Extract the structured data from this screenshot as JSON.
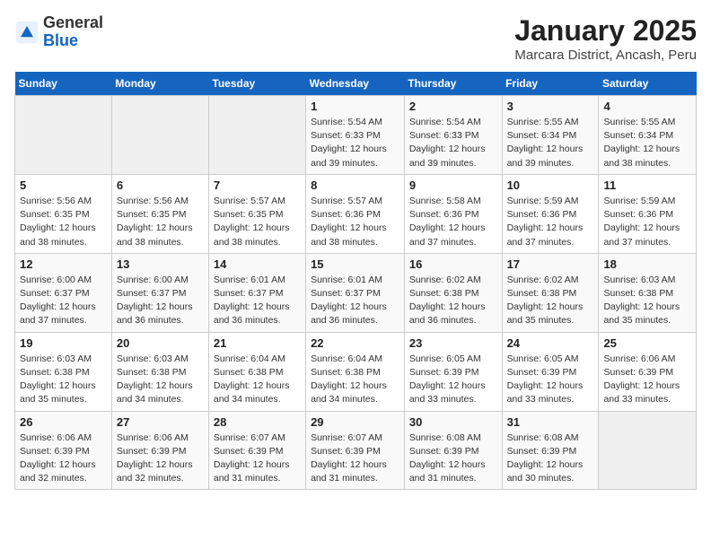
{
  "header": {
    "logo_general": "General",
    "logo_blue": "Blue",
    "title": "January 2025",
    "subtitle": "Marcara District, Ancash, Peru"
  },
  "days_of_week": [
    "Sunday",
    "Monday",
    "Tuesday",
    "Wednesday",
    "Thursday",
    "Friday",
    "Saturday"
  ],
  "weeks": [
    [
      {
        "day": "",
        "info": ""
      },
      {
        "day": "",
        "info": ""
      },
      {
        "day": "",
        "info": ""
      },
      {
        "day": "1",
        "info": "Sunrise: 5:54 AM\nSunset: 6:33 PM\nDaylight: 12 hours and 39 minutes."
      },
      {
        "day": "2",
        "info": "Sunrise: 5:54 AM\nSunset: 6:33 PM\nDaylight: 12 hours and 39 minutes."
      },
      {
        "day": "3",
        "info": "Sunrise: 5:55 AM\nSunset: 6:34 PM\nDaylight: 12 hours and 39 minutes."
      },
      {
        "day": "4",
        "info": "Sunrise: 5:55 AM\nSunset: 6:34 PM\nDaylight: 12 hours and 38 minutes."
      }
    ],
    [
      {
        "day": "5",
        "info": "Sunrise: 5:56 AM\nSunset: 6:35 PM\nDaylight: 12 hours and 38 minutes."
      },
      {
        "day": "6",
        "info": "Sunrise: 5:56 AM\nSunset: 6:35 PM\nDaylight: 12 hours and 38 minutes."
      },
      {
        "day": "7",
        "info": "Sunrise: 5:57 AM\nSunset: 6:35 PM\nDaylight: 12 hours and 38 minutes."
      },
      {
        "day": "8",
        "info": "Sunrise: 5:57 AM\nSunset: 6:36 PM\nDaylight: 12 hours and 38 minutes."
      },
      {
        "day": "9",
        "info": "Sunrise: 5:58 AM\nSunset: 6:36 PM\nDaylight: 12 hours and 37 minutes."
      },
      {
        "day": "10",
        "info": "Sunrise: 5:59 AM\nSunset: 6:36 PM\nDaylight: 12 hours and 37 minutes."
      },
      {
        "day": "11",
        "info": "Sunrise: 5:59 AM\nSunset: 6:36 PM\nDaylight: 12 hours and 37 minutes."
      }
    ],
    [
      {
        "day": "12",
        "info": "Sunrise: 6:00 AM\nSunset: 6:37 PM\nDaylight: 12 hours and 37 minutes."
      },
      {
        "day": "13",
        "info": "Sunrise: 6:00 AM\nSunset: 6:37 PM\nDaylight: 12 hours and 36 minutes."
      },
      {
        "day": "14",
        "info": "Sunrise: 6:01 AM\nSunset: 6:37 PM\nDaylight: 12 hours and 36 minutes."
      },
      {
        "day": "15",
        "info": "Sunrise: 6:01 AM\nSunset: 6:37 PM\nDaylight: 12 hours and 36 minutes."
      },
      {
        "day": "16",
        "info": "Sunrise: 6:02 AM\nSunset: 6:38 PM\nDaylight: 12 hours and 36 minutes."
      },
      {
        "day": "17",
        "info": "Sunrise: 6:02 AM\nSunset: 6:38 PM\nDaylight: 12 hours and 35 minutes."
      },
      {
        "day": "18",
        "info": "Sunrise: 6:03 AM\nSunset: 6:38 PM\nDaylight: 12 hours and 35 minutes."
      }
    ],
    [
      {
        "day": "19",
        "info": "Sunrise: 6:03 AM\nSunset: 6:38 PM\nDaylight: 12 hours and 35 minutes."
      },
      {
        "day": "20",
        "info": "Sunrise: 6:03 AM\nSunset: 6:38 PM\nDaylight: 12 hours and 34 minutes."
      },
      {
        "day": "21",
        "info": "Sunrise: 6:04 AM\nSunset: 6:38 PM\nDaylight: 12 hours and 34 minutes."
      },
      {
        "day": "22",
        "info": "Sunrise: 6:04 AM\nSunset: 6:38 PM\nDaylight: 12 hours and 34 minutes."
      },
      {
        "day": "23",
        "info": "Sunrise: 6:05 AM\nSunset: 6:39 PM\nDaylight: 12 hours and 33 minutes."
      },
      {
        "day": "24",
        "info": "Sunrise: 6:05 AM\nSunset: 6:39 PM\nDaylight: 12 hours and 33 minutes."
      },
      {
        "day": "25",
        "info": "Sunrise: 6:06 AM\nSunset: 6:39 PM\nDaylight: 12 hours and 33 minutes."
      }
    ],
    [
      {
        "day": "26",
        "info": "Sunrise: 6:06 AM\nSunset: 6:39 PM\nDaylight: 12 hours and 32 minutes."
      },
      {
        "day": "27",
        "info": "Sunrise: 6:06 AM\nSunset: 6:39 PM\nDaylight: 12 hours and 32 minutes."
      },
      {
        "day": "28",
        "info": "Sunrise: 6:07 AM\nSunset: 6:39 PM\nDaylight: 12 hours and 31 minutes."
      },
      {
        "day": "29",
        "info": "Sunrise: 6:07 AM\nSunset: 6:39 PM\nDaylight: 12 hours and 31 minutes."
      },
      {
        "day": "30",
        "info": "Sunrise: 6:08 AM\nSunset: 6:39 PM\nDaylight: 12 hours and 31 minutes."
      },
      {
        "day": "31",
        "info": "Sunrise: 6:08 AM\nSunset: 6:39 PM\nDaylight: 12 hours and 30 minutes."
      },
      {
        "day": "",
        "info": ""
      }
    ]
  ]
}
